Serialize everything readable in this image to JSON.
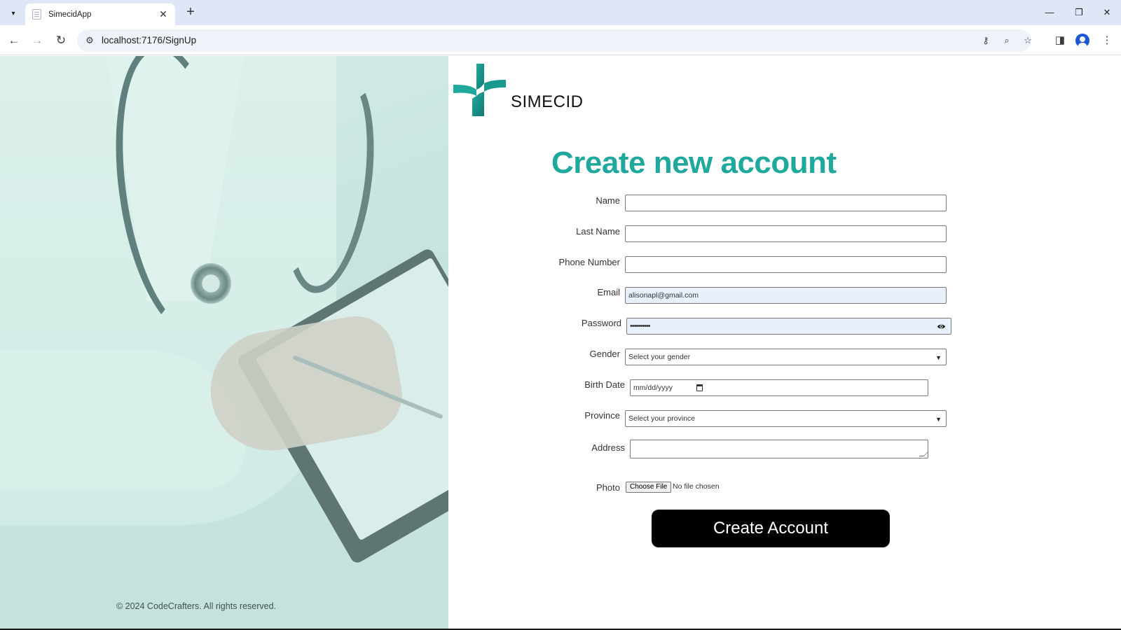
{
  "browser": {
    "tab_title": "SimecidApp",
    "tab_close": "✕",
    "new_tab": "+",
    "url": "localhost:7176/SignUp",
    "window_controls": {
      "minimize": "—",
      "restore": "❐",
      "close": "✕"
    }
  },
  "brand": {
    "logo_text": "SIMECID",
    "accent_color": "#1fa99d"
  },
  "form": {
    "title": "Create new account",
    "fields": {
      "name": {
        "label": "Name",
        "value": ""
      },
      "last_name": {
        "label": "Last Name",
        "value": ""
      },
      "phone": {
        "label": "Phone Number",
        "value": ""
      },
      "email": {
        "label": "Email",
        "value": "alisonapl@gmail.com"
      },
      "password": {
        "label": "Password",
        "value": "••••••••••"
      },
      "gender": {
        "label": "Gender",
        "selected": "Select your gender"
      },
      "birth_date": {
        "label": "Birth Date",
        "placeholder": "mm/dd/yyyy"
      },
      "province": {
        "label": "Province",
        "selected": "Select your province"
      },
      "address": {
        "label": "Address",
        "value": ""
      },
      "photo": {
        "label": "Photo",
        "button": "Choose File",
        "status": "No file chosen"
      }
    },
    "submit_label": "Create Account"
  },
  "footer": {
    "copyright": "© 2024 CodeCrafters. All rights reserved."
  }
}
